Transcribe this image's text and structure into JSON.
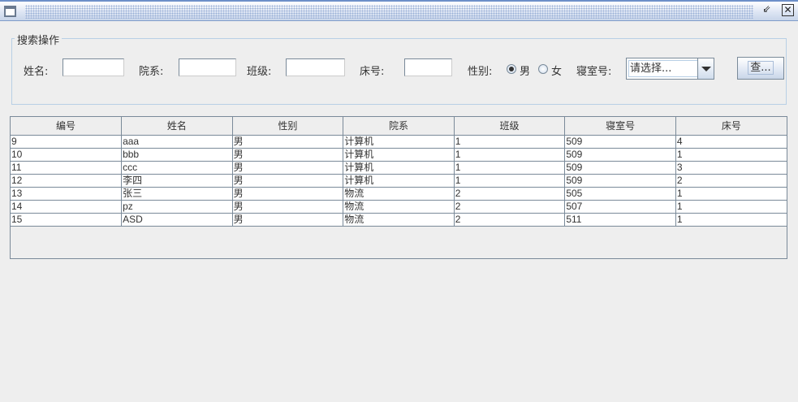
{
  "window": {
    "minimize_icon": "restore-icon",
    "close_icon": "close-icon"
  },
  "search": {
    "group_title": "搜索操作",
    "name_label": "姓名:",
    "name_value": "",
    "dept_label": "院系:",
    "dept_value": "",
    "class_label": "班级:",
    "class_value": "",
    "bed_label": "床号:",
    "bed_value": "",
    "gender_label": "性别:",
    "gender_male": "男",
    "gender_female": "女",
    "gender_selected": "男",
    "dorm_label": "寝室号:",
    "dorm_selected": "请选择...",
    "search_button": "查..."
  },
  "table": {
    "columns": [
      "编号",
      "姓名",
      "性别",
      "院系",
      "班级",
      "寝室号",
      "床号"
    ],
    "rows": [
      [
        "9",
        "aaa",
        "男",
        "计算机",
        "1",
        "509",
        "4"
      ],
      [
        "10",
        "bbb",
        "男",
        "计算机",
        "1",
        "509",
        "1"
      ],
      [
        "11",
        "ccc",
        "男",
        "计算机",
        "1",
        "509",
        "3"
      ],
      [
        "12",
        "李四",
        "男",
        "计算机",
        "1",
        "509",
        "2"
      ],
      [
        "13",
        "张三",
        "男",
        "物流",
        "2",
        "505",
        "1"
      ],
      [
        "14",
        "pz",
        "男",
        "物流",
        "2",
        "507",
        "1"
      ],
      [
        "15",
        "ASD",
        "男",
        "物流",
        "2",
        "511",
        "1"
      ]
    ]
  }
}
